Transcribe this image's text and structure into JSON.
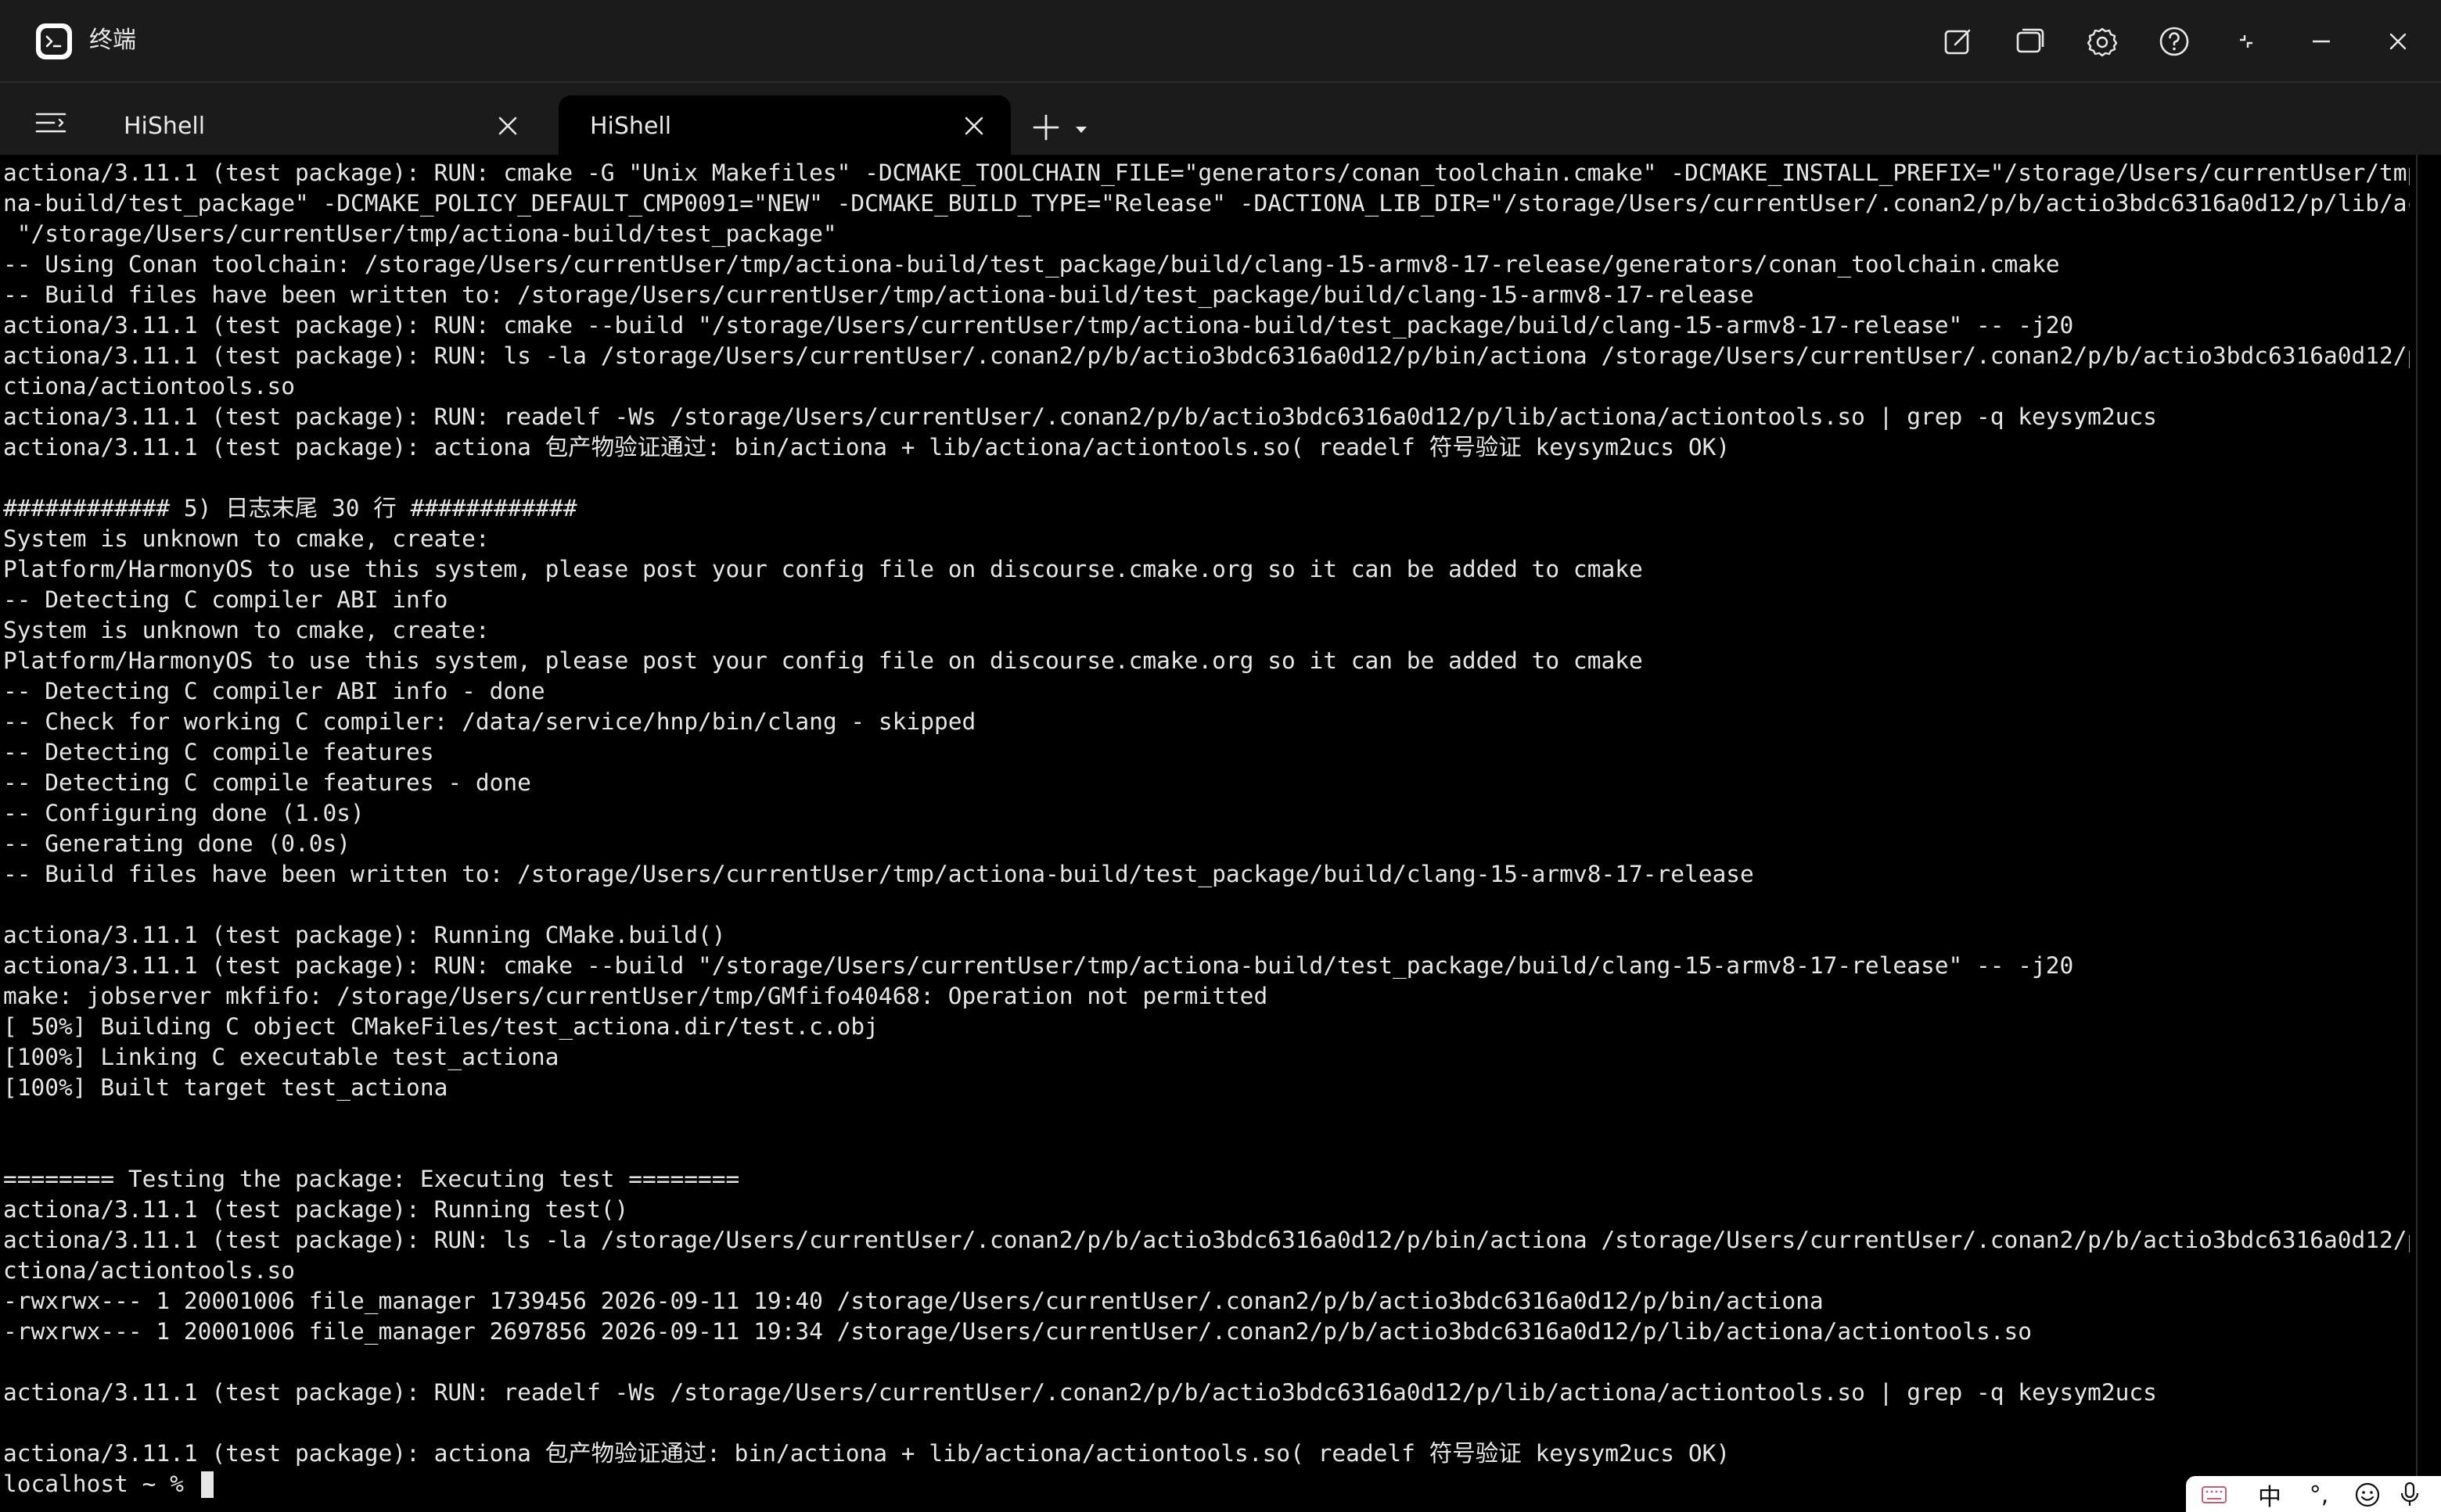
{
  "window": {
    "title": "终端",
    "controls": [
      "compose-icon",
      "window-icon",
      "gear-icon",
      "help-icon",
      "fullscreen-icon",
      "minimize-icon",
      "close-icon"
    ]
  },
  "tabs": [
    {
      "label": "HiShell",
      "active": false
    },
    {
      "label": "HiShell",
      "active": true
    }
  ],
  "terminal": {
    "lines": [
      "actiona/3.11.1 (test package): RUN: cmake -G \"Unix Makefiles\" -DCMAKE_TOOLCHAIN_FILE=\"generators/conan_toolchain.cmake\" -DCMAKE_INSTALL_PREFIX=\"/storage/Users/currentUser/tmp/actio",
      "na-build/test_package\" -DCMAKE_POLICY_DEFAULT_CMP0091=\"NEW\" -DCMAKE_BUILD_TYPE=\"Release\" -DACTIONA_LIB_DIR=\"/storage/Users/currentUser/.conan2/p/b/actio3bdc6316a0d12/p/lib/actiona\"",
      " \"/storage/Users/currentUser/tmp/actiona-build/test_package\"",
      "-- Using Conan toolchain: /storage/Users/currentUser/tmp/actiona-build/test_package/build/clang-15-armv8-17-release/generators/conan_toolchain.cmake",
      "-- Build files have been written to: /storage/Users/currentUser/tmp/actiona-build/test_package/build/clang-15-armv8-17-release",
      "actiona/3.11.1 (test package): RUN: cmake --build \"/storage/Users/currentUser/tmp/actiona-build/test_package/build/clang-15-armv8-17-release\" -- -j20",
      "actiona/3.11.1 (test package): RUN: ls -la /storage/Users/currentUser/.conan2/p/b/actio3bdc6316a0d12/p/bin/actiona /storage/Users/currentUser/.conan2/p/b/actio3bdc6316a0d12/p/lib/a",
      "ctiona/actiontools.so",
      "actiona/3.11.1 (test package): RUN: readelf -Ws /storage/Users/currentUser/.conan2/p/b/actio3bdc6316a0d12/p/lib/actiona/actiontools.so | grep -q keysym2ucs",
      "actiona/3.11.1 (test package): actiona 包产物验证通过: bin/actiona + lib/actiona/actiontools.so( readelf 符号验证 keysym2ucs OK)",
      "",
      "############ 5) 日志末尾 30 行 ############",
      "System is unknown to cmake, create:",
      "Platform/HarmonyOS to use this system, please post your config file on discourse.cmake.org so it can be added to cmake",
      "-- Detecting C compiler ABI info",
      "System is unknown to cmake, create:",
      "Platform/HarmonyOS to use this system, please post your config file on discourse.cmake.org so it can be added to cmake",
      "-- Detecting C compiler ABI info - done",
      "-- Check for working C compiler: /data/service/hnp/bin/clang - skipped",
      "-- Detecting C compile features",
      "-- Detecting C compile features - done",
      "-- Configuring done (1.0s)",
      "-- Generating done (0.0s)",
      "-- Build files have been written to: /storage/Users/currentUser/tmp/actiona-build/test_package/build/clang-15-armv8-17-release",
      "",
      "actiona/3.11.1 (test package): Running CMake.build()",
      "actiona/3.11.1 (test package): RUN: cmake --build \"/storage/Users/currentUser/tmp/actiona-build/test_package/build/clang-15-armv8-17-release\" -- -j20",
      "make: jobserver mkfifo: /storage/Users/currentUser/tmp/GMfifo40468: Operation not permitted",
      "[ 50%] Building C object CMakeFiles/test_actiona.dir/test.c.obj",
      "[100%] Linking C executable test_actiona",
      "[100%] Built target test_actiona",
      "",
      "",
      "======== Testing the package: Executing test ========",
      "actiona/3.11.1 (test package): Running test()",
      "actiona/3.11.1 (test package): RUN: ls -la /storage/Users/currentUser/.conan2/p/b/actio3bdc6316a0d12/p/bin/actiona /storage/Users/currentUser/.conan2/p/b/actio3bdc6316a0d12/p/lib/a",
      "ctiona/actiontools.so",
      "-rwxrwx--- 1 20001006 file_manager 1739456 2026-09-11 19:40 /storage/Users/currentUser/.conan2/p/b/actio3bdc6316a0d12/p/bin/actiona",
      "-rwxrwx--- 1 20001006 file_manager 2697856 2026-09-11 19:34 /storage/Users/currentUser/.conan2/p/b/actio3bdc6316a0d12/p/lib/actiona/actiontools.so",
      "",
      "actiona/3.11.1 (test package): RUN: readelf -Ws /storage/Users/currentUser/.conan2/p/b/actio3bdc6316a0d12/p/lib/actiona/actiontools.so | grep -q keysym2ucs",
      "",
      "actiona/3.11.1 (test package): actiona 包产物验证通过: bin/actiona + lib/actiona/actiontools.so( readelf 符号验证 keysym2ucs OK)"
    ],
    "prompt": "localhost ~ % "
  },
  "ime": {
    "mode_char": "中",
    "punct": "°,",
    "icons": [
      "keyboard-icon",
      "emoji-icon",
      "mic-icon"
    ]
  },
  "colors": {
    "titlebar_bg": "#1b1b1c",
    "terminal_bg": "#000000",
    "text": "#e6e6e6"
  }
}
